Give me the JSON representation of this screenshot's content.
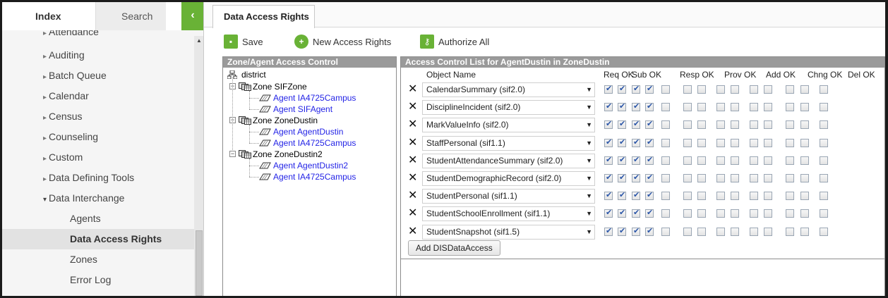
{
  "nav": {
    "tabs": [
      "Index",
      "Search"
    ],
    "collapse_icon": "chevron-left-icon",
    "items": [
      {
        "label": "Attendance",
        "level": 1,
        "expanded": false,
        "clipped": true
      },
      {
        "label": "Auditing",
        "level": 1,
        "expanded": false
      },
      {
        "label": "Batch Queue",
        "level": 1,
        "expanded": false
      },
      {
        "label": "Calendar",
        "level": 1,
        "expanded": false
      },
      {
        "label": "Census",
        "level": 1,
        "expanded": false
      },
      {
        "label": "Counseling",
        "level": 1,
        "expanded": false
      },
      {
        "label": "Custom",
        "level": 1,
        "expanded": false
      },
      {
        "label": "Data Defining Tools",
        "level": 1,
        "expanded": false
      },
      {
        "label": "Data Interchange",
        "level": 1,
        "expanded": true
      },
      {
        "label": "Agents",
        "level": 2
      },
      {
        "label": "Data Access Rights",
        "level": 2,
        "active": true
      },
      {
        "label": "Zones",
        "level": 2
      },
      {
        "label": "Error Log",
        "level": 2
      }
    ]
  },
  "main": {
    "tab": "Data Access Rights",
    "toolbar": {
      "save": "Save",
      "new_rights": "New Access Rights",
      "authorize_all": "Authorize All"
    }
  },
  "zone_panel": {
    "title": "Zone/Agent Access Control",
    "root": "district",
    "zones": [
      {
        "label": "Zone SIFZone",
        "agents": [
          "Agent IA4725Campus",
          "Agent SIFAgent"
        ]
      },
      {
        "label": "Zone ZoneDustin",
        "agents": [
          "Agent AgentDustin",
          "Agent IA4725Campus"
        ]
      },
      {
        "label": "Zone ZoneDustin2",
        "agents": [
          "Agent AgentDustin2",
          "Agent IA4725Campus"
        ]
      }
    ]
  },
  "acl": {
    "title": "Access Control List for AgentDustin in ZoneDustin",
    "object_header": "Object Name",
    "columns": [
      "Req OK",
      "Sub OK",
      "Resp OK",
      "Prov OK",
      "Add OK",
      "Chng OK",
      "Del OK"
    ],
    "rows": [
      {
        "object": "CalendarSummary (sif2.0)",
        "checks": [
          true,
          true,
          true,
          true,
          false,
          false,
          false,
          false,
          false,
          false,
          false,
          false,
          false,
          false
        ]
      },
      {
        "object": "DisciplineIncident (sif2.0)",
        "checks": [
          true,
          true,
          true,
          true,
          false,
          false,
          false,
          false,
          false,
          false,
          false,
          false,
          false,
          false
        ]
      },
      {
        "object": "MarkValueInfo (sif2.0)",
        "checks": [
          true,
          true,
          true,
          true,
          false,
          false,
          false,
          false,
          false,
          false,
          false,
          false,
          false,
          false
        ]
      },
      {
        "object": "StaffPersonal (sif1.1)",
        "checks": [
          true,
          true,
          true,
          true,
          false,
          false,
          false,
          false,
          false,
          false,
          false,
          false,
          false,
          false
        ]
      },
      {
        "object": "StudentAttendanceSummary (sif2.0)",
        "checks": [
          true,
          true,
          true,
          true,
          false,
          false,
          false,
          false,
          false,
          false,
          false,
          false,
          false,
          false
        ]
      },
      {
        "object": "StudentDemographicRecord (sif2.0)",
        "checks": [
          true,
          true,
          true,
          true,
          false,
          false,
          false,
          false,
          false,
          false,
          false,
          false,
          false,
          false
        ]
      },
      {
        "object": "StudentPersonal (sif1.1)",
        "checks": [
          true,
          true,
          true,
          true,
          false,
          false,
          false,
          false,
          false,
          false,
          false,
          false,
          false,
          false
        ]
      },
      {
        "object": "StudentSchoolEnrollment (sif1.1)",
        "checks": [
          true,
          true,
          true,
          true,
          false,
          false,
          false,
          false,
          false,
          false,
          false,
          false,
          false,
          false
        ]
      },
      {
        "object": "StudentSnapshot (sif1.5)",
        "checks": [
          true,
          true,
          true,
          true,
          false,
          false,
          false,
          false,
          false,
          false,
          false,
          false,
          false,
          false
        ]
      }
    ],
    "add_button": "Add DISDataAccess"
  },
  "colors": {
    "accent": "#69b236",
    "header": "#9a9a9a",
    "agent_link": "#2424e6"
  }
}
